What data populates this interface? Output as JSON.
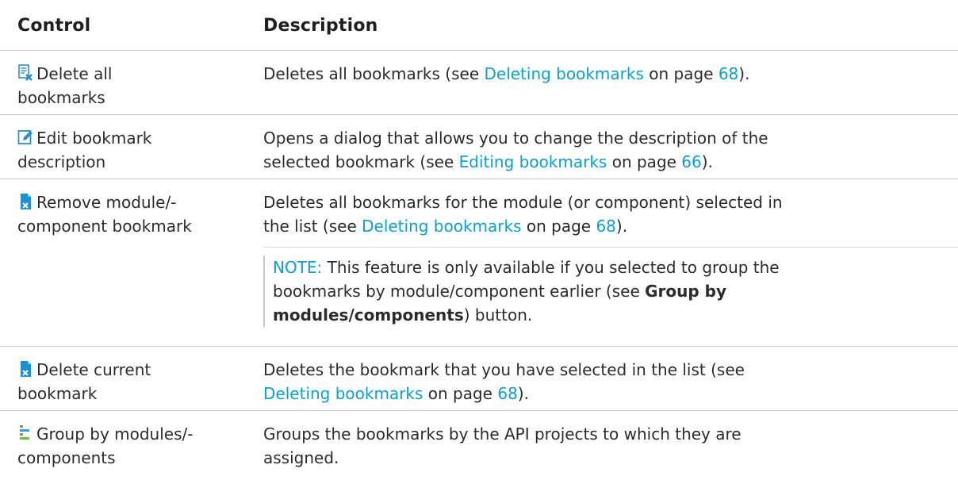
{
  "header": {
    "control": "Control",
    "description": "Description"
  },
  "rows": [
    {
      "control": [
        "Delete all",
        "bookmarks"
      ],
      "icon": "delete-all-icon",
      "desc": {
        "pre": "Deletes all bookmarks (see ",
        "link": "Deleting bookmarks",
        "mid": " on page ",
        "page": "68",
        "post": ")."
      }
    },
    {
      "control": [
        "Edit bookmark",
        "description"
      ],
      "icon": "edit-icon",
      "desc": {
        "line1": "Opens a dialog that allows you to change the description of the",
        "pre": "selected bookmark (see ",
        "link": "Editing bookmarks",
        "mid": " on page ",
        "page": "66",
        "post": ")."
      }
    },
    {
      "control": [
        "Remove module/-",
        "component bookmark"
      ],
      "icon": "remove-bookmark-icon",
      "desc": {
        "line1": "Deletes all bookmarks for the module (or component) selected in",
        "pre": "the list (see ",
        "link": "Deleting bookmarks",
        "mid": " on page ",
        "page": "68",
        "post": ")."
      },
      "note": {
        "label": "NOTE:",
        "line1": " This feature is only available if you selected to group the",
        "line2_pre": "bookmarks by module/component earlier (see ",
        "line2_bold": "Group by",
        "line3_bold": "modules/components",
        "line3_post": ") button."
      }
    },
    {
      "control": [
        "Delete current",
        "bookmark"
      ],
      "icon": "delete-current-icon",
      "desc": {
        "line1": "Deletes the bookmark that you have selected in the list (see",
        "link": "Deleting bookmarks",
        "mid": " on page ",
        "page": "68",
        "post": ")."
      }
    },
    {
      "control": [
        "Group by modules/-",
        "components"
      ],
      "icon": "group-icon",
      "desc": {
        "line1": "Groups the bookmarks by the API projects to which they are",
        "line2": "assigned."
      }
    }
  ]
}
